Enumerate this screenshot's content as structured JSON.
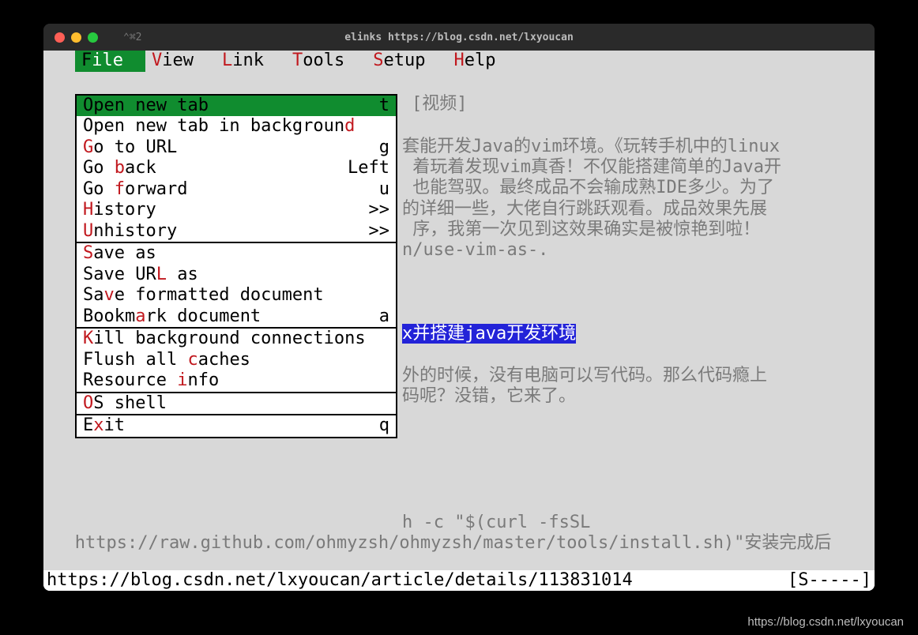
{
  "tab_short": "⌃⌘2",
  "titlebar": "elinks https://blog.csdn.net/lxyoucan",
  "menus": {
    "file": {
      "hot": "F",
      "rest": "ile"
    },
    "view": {
      "hot": "V",
      "rest": "iew"
    },
    "link": {
      "hot": "L",
      "rest": "ink"
    },
    "tools": {
      "hot": "T",
      "rest": "ools"
    },
    "setup": {
      "hot": "S",
      "rest": "etup"
    },
    "help": {
      "hot": "H",
      "rest": "elp"
    }
  },
  "file_menu": {
    "g1": [
      {
        "pre": "Open new ",
        "hot": "t",
        "post": "ab",
        "key": "t",
        "sel": true
      },
      {
        "pre": "Open new tab in backgroun",
        "hot": "d",
        "post": "",
        "key": ""
      },
      {
        "pre": "",
        "hot": "G",
        "post": "o to URL",
        "key": "g"
      },
      {
        "pre": "Go ",
        "hot": "b",
        "post": "ack",
        "key": "Left"
      },
      {
        "pre": "Go ",
        "hot": "f",
        "post": "orward",
        "key": "u"
      },
      {
        "pre": "",
        "hot": "H",
        "post": "istory",
        "key": ">>"
      },
      {
        "pre": "",
        "hot": "U",
        "post": "nhistory",
        "key": ">>"
      }
    ],
    "g2": [
      {
        "pre": "",
        "hot": "S",
        "post": "ave as",
        "key": ""
      },
      {
        "pre": "Save UR",
        "hot": "L",
        "post": " as",
        "key": ""
      },
      {
        "pre": "Sa",
        "hot": "v",
        "post": "e formatted document",
        "key": ""
      },
      {
        "pre": "Bookm",
        "hot": "a",
        "post": "rk document",
        "key": "a"
      }
    ],
    "g3": [
      {
        "pre": "",
        "hot": "K",
        "post": "ill background connections",
        "key": ""
      },
      {
        "pre": "Flush all ",
        "hot": "c",
        "post": "aches",
        "key": ""
      },
      {
        "pre": "Resource ",
        "hot": "i",
        "post": "nfo",
        "key": ""
      }
    ],
    "g4": [
      {
        "pre": "",
        "hot": "O",
        "post": "S shell",
        "key": ""
      }
    ],
    "g5": [
      {
        "pre": "E",
        "hot": "x",
        "post": "it",
        "key": "q"
      }
    ]
  },
  "page": {
    "video": "[视频]",
    "para1_l1": "套能开发Java的vim环境。《玩转手机中的linux",
    "para1_l2": " 着玩着发现vim真香！不仅能搭建简单的Java开",
    "para1_l3": " 也能驾驭。最终成品不会输成熟IDE多少。为了",
    "para1_l4": "的详细一些，大佬自行跳跃观看。成品效果先展",
    "para1_l5": " 序，我第一次见到这效果确实是被惊艳到啦！",
    "para1_l6": "n/use-vim-as-.",
    "headline": "x并搭建java开发环境",
    "para2_l1": "外的时候，没有电脑可以写代码。那么代码瘾上",
    "para2_l2": "码呢？没错，它来了。",
    "cmd_l1": "h -c \"$(curl -fsSL",
    "cmd_l2": "   https://raw.github.com/ohmyzsh/ohmyzsh/master/tools/install.sh)\"安装完成后"
  },
  "status": {
    "left": "https://blog.csdn.net/lxyoucan/article/details/113831014",
    "right": "[S-----]"
  },
  "watermark": "https://blog.csdn.net/lxyoucan"
}
